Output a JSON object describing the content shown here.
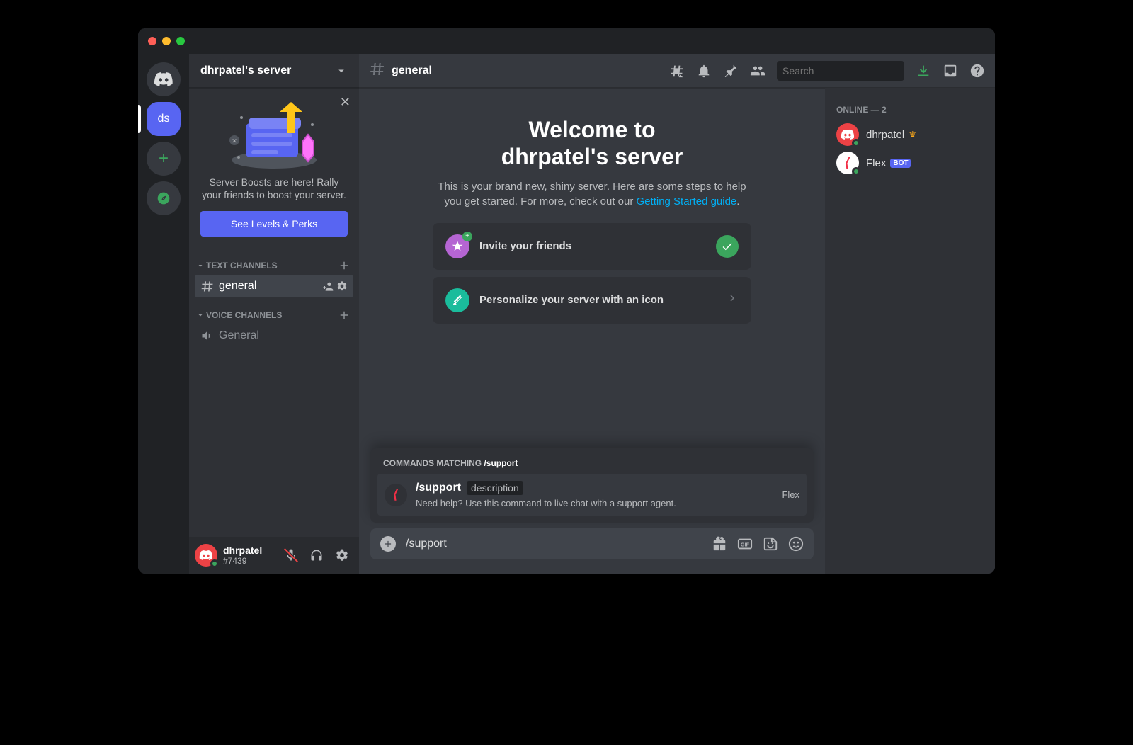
{
  "server": {
    "name": "dhrpatel's server",
    "icon_label": "ds"
  },
  "boost": {
    "text": "Server Boosts are here! Rally your friends to boost your server.",
    "button": "See Levels & Perks"
  },
  "categories": {
    "text": {
      "label": "Text Channels"
    },
    "voice": {
      "label": "Voice Channels"
    }
  },
  "channels": {
    "text_general": "general",
    "voice_general": "General"
  },
  "user": {
    "name": "dhrpatel",
    "tag": "#7439"
  },
  "toolbar": {
    "channel": "general",
    "search_placeholder": "Search"
  },
  "welcome": {
    "line1": "Welcome to",
    "line2": "dhrpatel's server",
    "subtitle_a": "This is your brand new, shiny server. Here are some steps to help you get started. For more, check out our ",
    "link": "Getting Started guide",
    "subtitle_b": "."
  },
  "cards": {
    "invite": "Invite your friends",
    "personalize": "Personalize your server with an icon"
  },
  "autocomplete": {
    "header_a": "COMMANDS MATCHING ",
    "header_q": "/support",
    "cmd": "/support",
    "desc_label": "description",
    "subtitle": "Need help? Use this command to live chat with a support agent.",
    "source": "Flex"
  },
  "composer": {
    "value": "/support"
  },
  "members": {
    "online_label": "Online — 2",
    "user1": "dhrpatel",
    "user2": "Flex",
    "bot_tag": "BOT"
  }
}
